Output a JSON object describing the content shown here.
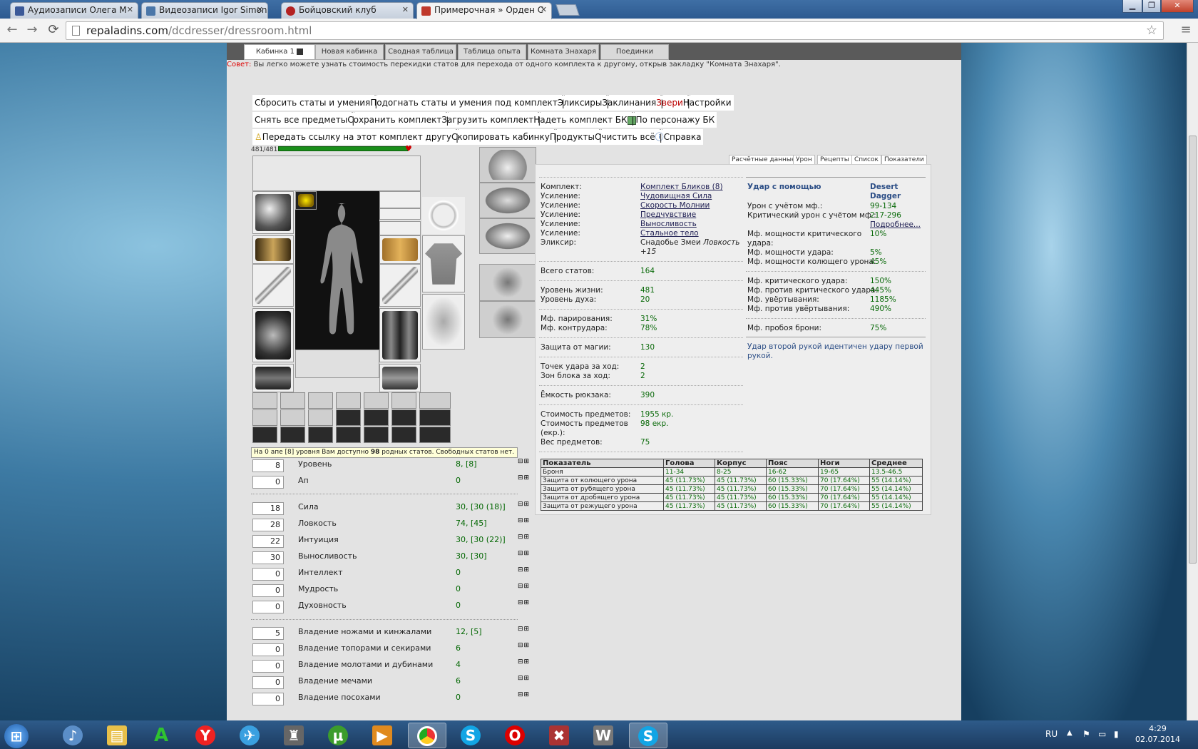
{
  "browser": {
    "tabs": [
      {
        "label": "Аудиозаписи Олега М",
        "fav": "#3b5998",
        "active": false
      },
      {
        "label": "Видеозаписи Igor Simone",
        "fav": "#4a76a8",
        "active": false
      },
      {
        "label": "Бойцовский клуб",
        "fav": "#b42222",
        "active": false
      },
      {
        "label": "Примерочная » Орден С",
        "fav": "#c0392b",
        "active": true
      }
    ],
    "url_host": "repaladins.com",
    "url_path": "/dcdresser/dressroom.html",
    "back": "←",
    "forward": "→",
    "reload": "⟳",
    "star": "☆",
    "menu": "≡"
  },
  "page": {
    "tabs": [
      "Кабинка 1",
      "Новая кабинка",
      "Сводная таблица",
      "Таблица опыта",
      "Комната Знахаря",
      "Поединки"
    ],
    "tip_label": "Совет:",
    "tip_text": " Вы легко можете узнать стоимость перекидки статов для перехода от одного комплекта к другому, открыв закладку \"Комната Знахаря\".",
    "menu_row1": [
      "Сбросить статы и умения",
      "Подогнать статы и умения под комплект",
      "Эликсиры",
      "Заклинания",
      "Звери",
      "Настройки"
    ],
    "menu_row2": [
      "Снять все предметы",
      "Сохранить комплект",
      "Загрузить комплект",
      "Надеть комплект БК",
      "По персонажу БК"
    ],
    "menu_row3": [
      "Передать ссылку на этот комплект другу",
      "Скопировать кабинку",
      "Продукты",
      "Очистить всё",
      "Справка"
    ],
    "hp": "481/481",
    "stat_note_pre": "На 0 апе [8] уровня Вам доступно ",
    "stat_note_num": "98",
    "stat_note_post": " родных статов. Свободных статов нет.",
    "stats_group1": [
      {
        "input": "8",
        "label": "Уровень",
        "value": "8, [8]"
      },
      {
        "input": "0",
        "label": "Ап",
        "value": "0"
      }
    ],
    "stats_group2": [
      {
        "input": "18",
        "label": "Сила",
        "value": "30, [30 (18)]"
      },
      {
        "input": "28",
        "label": "Ловкость",
        "value": "74, [45]"
      },
      {
        "input": "22",
        "label": "Интуиция",
        "value": "30, [30 (22)]"
      },
      {
        "input": "30",
        "label": "Выносливость",
        "value": "30, [30]"
      },
      {
        "input": "0",
        "label": "Интеллект",
        "value": "0"
      },
      {
        "input": "0",
        "label": "Мудрость",
        "value": "0"
      },
      {
        "input": "0",
        "label": "Духовность",
        "value": "0"
      }
    ],
    "stats_group3": [
      {
        "input": "5",
        "label": "Владение ножами и кинжалами",
        "value": "12, [5]"
      },
      {
        "input": "0",
        "label": "Владение топорами и секирами",
        "value": "6"
      },
      {
        "input": "0",
        "label": "Владение молотами и дубинами",
        "value": "4"
      },
      {
        "input": "0",
        "label": "Владение мечами",
        "value": "6"
      },
      {
        "input": "0",
        "label": "Владение посохами",
        "value": "0"
      }
    ],
    "pm": "⊟⊞"
  },
  "right": {
    "tabs": [
      "Расчётные данные",
      "Урон",
      "Рецепты",
      "Список",
      "Показатели"
    ],
    "set_rows": [
      {
        "k": "Комплект:",
        "v": "Комплект Бликов (8)",
        "link": true
      },
      {
        "k": "Усиление:",
        "v": "Чудовищная Сила",
        "link": true
      },
      {
        "k": "Усиление:",
        "v": "Скорость Молнии",
        "link": true
      },
      {
        "k": "Усиление:",
        "v": "Предчувствие",
        "link": true
      },
      {
        "k": "Усиление:",
        "v": "Выносливость",
        "link": true
      },
      {
        "k": "Усиление:",
        "v": "Стальное тело",
        "link": true
      }
    ],
    "elixir_k": "Эликсир:",
    "elixir_v": "Снадобье Змеи",
    "elixir_v2": "Ловкость",
    "elixir_v3": "+15",
    "stats": [
      {
        "k": "Всего статов:",
        "v": "164"
      },
      {
        "k": "Уровень жизни:",
        "v": "481"
      },
      {
        "k": "Уровень духа:",
        "v": "20"
      },
      {
        "k": "Мф. парирования:",
        "v": "31%"
      },
      {
        "k": "Мф. контрудара:",
        "v": "78%"
      },
      {
        "k": "Защита от магии:",
        "v": "130"
      },
      {
        "k": "Точек удара за ход:",
        "v": "2"
      },
      {
        "k": "Зон блока за ход:",
        "v": "2"
      },
      {
        "k": "Ёмкость рюкзака:",
        "v": "390"
      },
      {
        "k": "Стоимость предметов:",
        "v": "1955 кр."
      },
      {
        "k": "Стоимость предметов (екр.):",
        "v": "98 екр."
      },
      {
        "k": "Вес предметов:",
        "v": "75"
      }
    ],
    "attack_hd": "Удар с помощью",
    "weapon": "Desert Dagger",
    "attack": [
      {
        "k": "Урон с учётом мф.:",
        "v": "99-134"
      },
      {
        "k": "Критический урон с учётом мф.:",
        "v": "217-296"
      },
      {
        "k": "",
        "v": "Подробнее..."
      },
      {
        "k": "Мф. мощности критического удара:",
        "v": "10%"
      },
      {
        "k": "Мф. мощности удара:",
        "v": "5%"
      },
      {
        "k": "Мф. мощности колющего урона:",
        "v": "45%"
      },
      {
        "k": "Мф. критического удара:",
        "v": "150%"
      },
      {
        "k": "Мф. против критического удара:",
        "v": "445%"
      },
      {
        "k": "Мф. увёртывания:",
        "v": "1185%"
      },
      {
        "k": "Мф. против увёртывания:",
        "v": "490%"
      },
      {
        "k": "Мф. пробоя брони:",
        "v": "75%"
      }
    ],
    "offhand_note": "Удар второй рукой идентичен удару первой рукой.",
    "table": {
      "headers": [
        "Показатель",
        "Голова",
        "Корпус",
        "Пояс",
        "Ноги",
        "Среднее"
      ],
      "rows": [
        [
          "Броня",
          "11-34",
          "8-25",
          "16-62",
          "19-65",
          "13.5-46.5"
        ],
        [
          "Защита от колющего урона",
          "45 (11.73%)",
          "45 (11.73%)",
          "60 (15.33%)",
          "70 (17.64%)",
          "55 (14.14%)"
        ],
        [
          "Защита от рубящего урона",
          "45 (11.73%)",
          "45 (11.73%)",
          "60 (15.33%)",
          "70 (17.64%)",
          "55 (14.14%)"
        ],
        [
          "Защита от дробящего урона",
          "45 (11.73%)",
          "45 (11.73%)",
          "60 (15.33%)",
          "70 (17.64%)",
          "55 (14.14%)"
        ],
        [
          "Защита от режущего урона",
          "45 (11.73%)",
          "45 (11.73%)",
          "60 (15.33%)",
          "70 (17.64%)",
          "55 (14.14%)"
        ]
      ]
    }
  },
  "taskbar": {
    "lang": "RU",
    "time": "4:29",
    "date": "02.07.2014"
  }
}
